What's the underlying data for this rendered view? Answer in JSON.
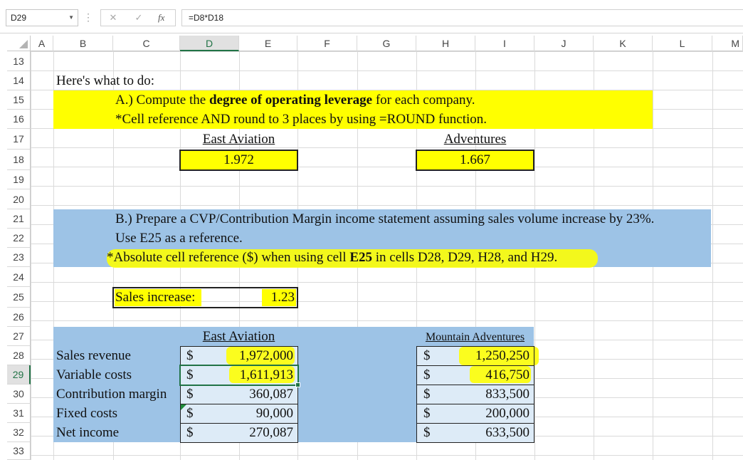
{
  "formula_bar": {
    "name_box": "D29",
    "fx_label": "fx",
    "cancel_glyph": "✕",
    "enter_glyph": "✓",
    "formula": "=D8*D18"
  },
  "columns": [
    "A",
    "B",
    "C",
    "D",
    "E",
    "F",
    "G",
    "H",
    "I",
    "J",
    "K",
    "L",
    "M"
  ],
  "rows": [
    "13",
    "14",
    "15",
    "16",
    "17",
    "18",
    "19",
    "20",
    "21",
    "22",
    "23",
    "24",
    "25",
    "26",
    "27",
    "28",
    "29",
    "30",
    "31",
    "32",
    "33"
  ],
  "sheet": {
    "intro": "Here's what to do:",
    "partA_prefix": "A.) Compute the ",
    "partA_bold": "degree of operating leverage",
    "partA_suffix": " for each company.",
    "partA_note": "*Cell reference AND round to 3 places by using =ROUND function.",
    "dol_east_label": "East Aviation",
    "dol_east_value": "1.972",
    "dol_adv_label": "Adventures",
    "dol_adv_value": "1.667",
    "partB_line1": "B.) Prepare a CVP/Contribution Margin income statement assuming sales volume increase by 23%.",
    "partB_line2": "Use E25 as a reference.",
    "partB_line3_prefix": "*Absolute cell reference ($) when using cell ",
    "partB_line3_bold": "E25",
    "partB_line3_suffix": " in cells D28, D29, H28, and H29.",
    "sales_increase_label": "Sales increase:",
    "sales_increase_value": "1.23",
    "east_header": "East Aviation",
    "mountain_header": "Mountain Adventures",
    "currency": "$",
    "statement_rows": [
      {
        "label": "Sales revenue",
        "east": "1,972,000",
        "mountain": "1,250,250"
      },
      {
        "label": "Variable costs",
        "east": "1,611,913",
        "mountain": "416,750"
      },
      {
        "label": "Contribution margin",
        "east": "360,087",
        "mountain": "833,500"
      },
      {
        "label": "Fixed costs",
        "east": "90,000",
        "mountain": "200,000"
      },
      {
        "label": "Net income",
        "east": "270,087",
        "mountain": "633,500"
      }
    ]
  },
  "colors": {
    "highlight_yellow": "#ffff00",
    "section_blue": "#9dc3e6",
    "light_blue_cell": "#ddebf7",
    "excel_green": "#217346"
  }
}
